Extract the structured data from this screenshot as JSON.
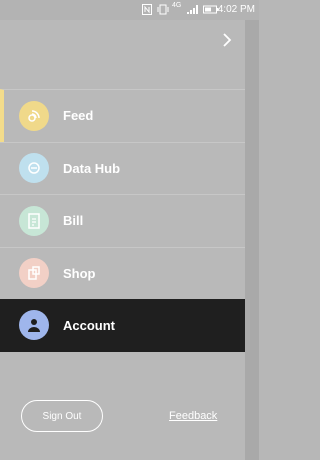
{
  "status_bar": {
    "time": "4:02 PM",
    "network_label": "4G"
  },
  "drawer": {
    "collapse_icon": "chevron-right-icon",
    "items": [
      {
        "label": "Feed",
        "icon": "feed-icon",
        "icon_color": "#f0d98a"
      },
      {
        "label": "Data Hub",
        "icon": "data-hub-icon",
        "icon_color": "#bfe0ee"
      },
      {
        "label": "Bill",
        "icon": "bill-icon",
        "icon_color": "#c7e6d6"
      },
      {
        "label": "Shop",
        "icon": "shop-icon",
        "icon_color": "#f2d0c6"
      },
      {
        "label": "Account",
        "icon": "account-icon",
        "icon_color": "#9fb6ec"
      }
    ],
    "sign_out_label": "Sign Out",
    "feedback_label": "Feedback"
  }
}
